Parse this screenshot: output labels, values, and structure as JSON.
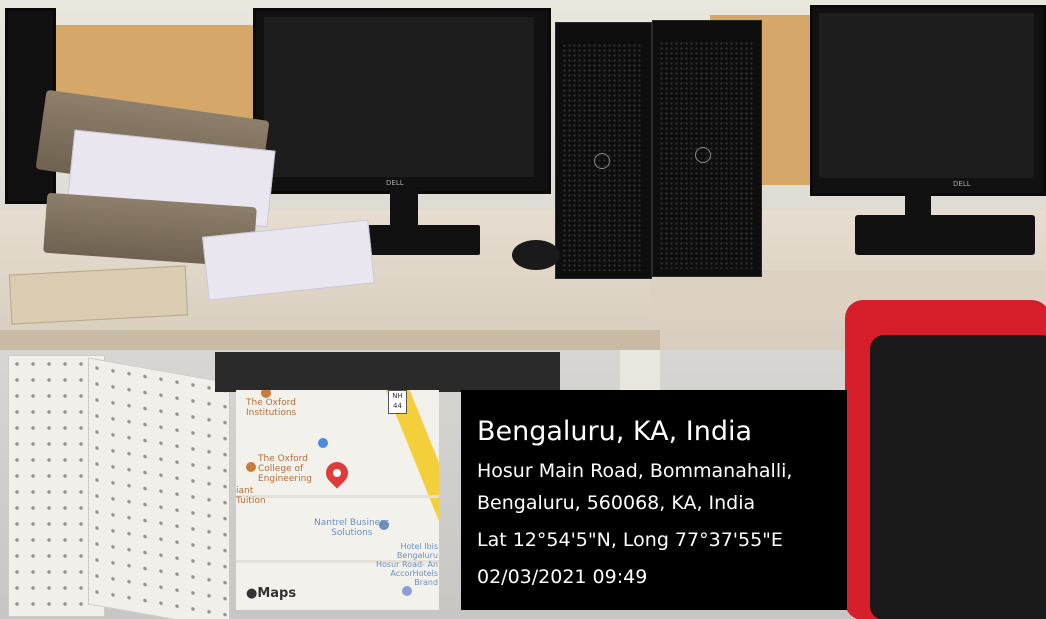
{
  "map_thumbnail": {
    "labels": {
      "oxford_institutions": "The Oxford\nInstitutions",
      "oxford_college": "The Oxford\nCollege of\nEngineering",
      "tuition_fragment": "iant\nTuition",
      "nantrel": "Nantrel Business\nSolutions",
      "hotel": "Hotel Ibis\nBengaluru\nHosur Road- An\nAccorHotels\nBrand",
      "road_badge": "NH\n44"
    },
    "watermark": "Maps",
    "icons": [
      "apple-logo-icon",
      "location-pin-icon",
      "parking-icon",
      "poi-icon"
    ],
    "colors": {
      "pin": "#e03a3a",
      "road": "#f4cf3c"
    }
  },
  "location_panel": {
    "city": "Bengaluru, KA, India",
    "address_line1": "Hosur Main Road, Bommanahalli,",
    "address_line2": "Bengaluru, 560068, KA, India",
    "coordinates": "Lat 12°54'5\"N, Long 77°37'55\"E",
    "timestamp": "02/03/2021 09:49"
  },
  "brand_labels": [
    "DELL",
    "DELL",
    "DELL"
  ]
}
